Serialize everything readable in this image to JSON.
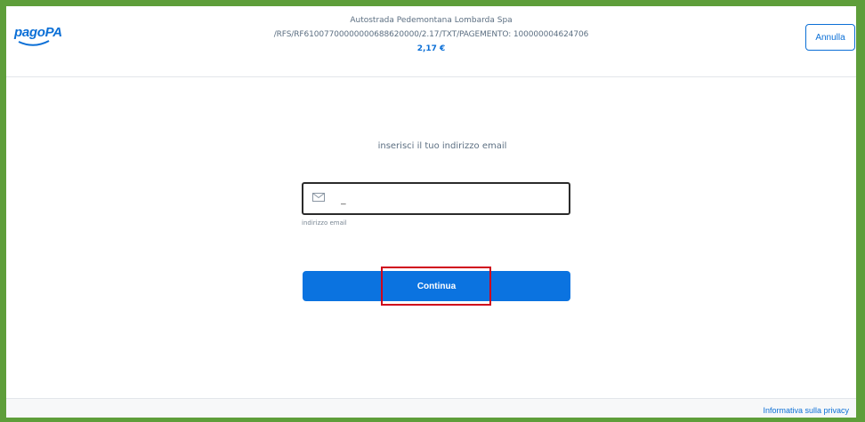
{
  "header": {
    "logo_text": "pagoPA",
    "merchant_name": "Autostrada Pedemontana Lombarda Spa",
    "payment_reference": "/RFS/RF61007700000000688620000/2.17/TXT/PAGEMENTO: 100000004624706",
    "amount": "2,17 €",
    "cancel_label": "Annulla"
  },
  "email_form": {
    "prompt": "inserisci il tuo indirizzo email",
    "input_value": "_",
    "field_label": "indirizzo email",
    "submit_label": "Continua"
  },
  "footer": {
    "privacy_label": "Informativa sulla privacy"
  },
  "colors": {
    "brand_blue": "#0b73e0",
    "frame_green": "#5e9e3a",
    "highlight_red": "#d0021b"
  }
}
